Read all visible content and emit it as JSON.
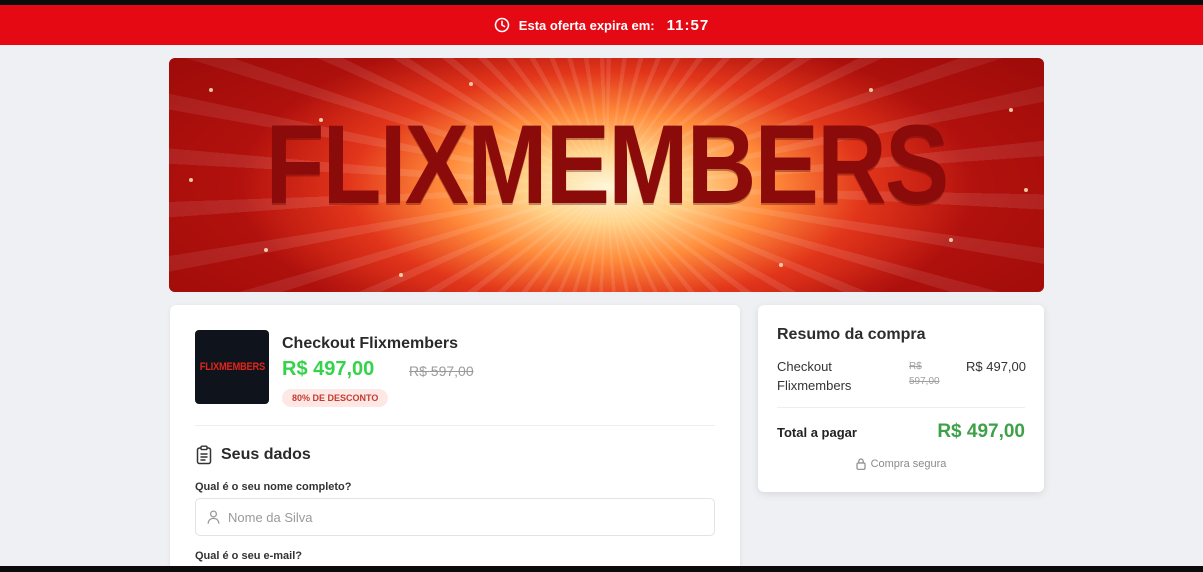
{
  "offer_bar": {
    "label": "Esta oferta expira em:",
    "timer": "11:57",
    "icon": "clock-icon",
    "color": "#e50914"
  },
  "banner": {
    "logo_text": "FLIXMEMBERS"
  },
  "product": {
    "thumb_text": "FLIXMEMBERS",
    "title": "Checkout Flixmembers",
    "price": "R$ 497,00",
    "old_price": "R$ 597,00",
    "discount_badge": "80% DE DESCONTO",
    "price_color": "#34d34a"
  },
  "form": {
    "section_title": "Seus dados",
    "section_icon": "clipboard-icon",
    "name_label": "Qual é o seu nome completo?",
    "name_placeholder": "Nome da Silva",
    "name_icon": "user-icon",
    "email_label": "Qual é o seu e-mail?"
  },
  "summary": {
    "title": "Resumo da compra",
    "item_name": "Checkout Flixmembers",
    "item_old_price": "R$ 597,00",
    "item_price": "R$ 497,00",
    "total_label": "Total a pagar",
    "total_value": "R$ 497,00",
    "secure_text": "Compra segura",
    "secure_icon": "lock-icon",
    "total_color": "#3fa04a"
  }
}
